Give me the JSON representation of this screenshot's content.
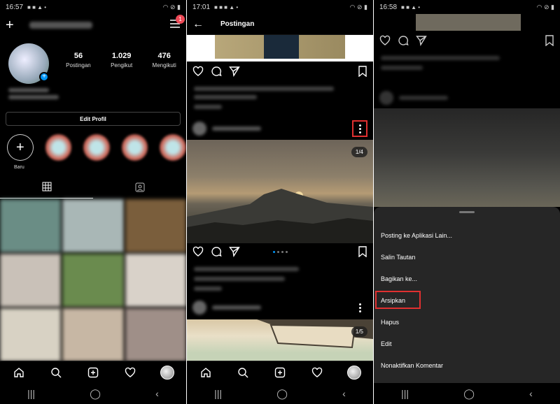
{
  "panel1": {
    "status": {
      "time": "16:57"
    },
    "badge_count": "1",
    "stats": [
      {
        "num": "56",
        "label": "Postingan"
      },
      {
        "num": "1.029",
        "label": "Pengikut"
      },
      {
        "num": "476",
        "label": "Mengikuti"
      }
    ],
    "edit_profile": "Edit Profil",
    "new_highlight": "Baru",
    "grid_colors": [
      "#6a8d85",
      "#a9b7b6",
      "#7a5e3c",
      "#c9c1b8",
      "#6a8b4e",
      "#d9d2c9",
      "#d8d2c4",
      "#c7b7a4",
      "#9f8f88"
    ]
  },
  "panel2": {
    "status": {
      "time": "17:01"
    },
    "title": "Postingan",
    "carousel1": "1/4",
    "carousel2": "1/5"
  },
  "panel3": {
    "status": {
      "time": "16:58"
    },
    "menu": [
      "Posting ke Aplikasi Lain...",
      "Salin Tautan",
      "Bagikan ke...",
      "Arsipkan",
      "Hapus",
      "Edit",
      "Nonaktifkan Komentar"
    ]
  },
  "colors": {
    "accent": "#0095f6",
    "highlight_box": "#e03030",
    "badge": "#ed4956"
  }
}
